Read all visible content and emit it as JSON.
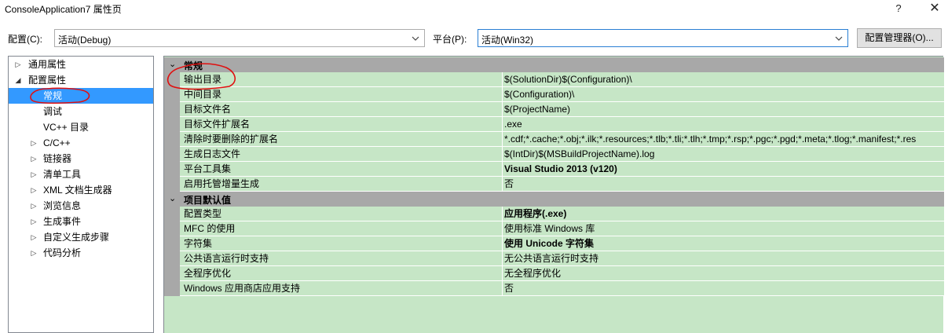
{
  "window": {
    "title": "ConsoleApplication7 属性页",
    "help_icon": "?",
    "close_icon": "✕"
  },
  "config_bar": {
    "config_label": "配置(C):",
    "config_value": "活动(Debug)",
    "platform_label": "平台(P):",
    "platform_value": "活动(Win32)",
    "manager_button": "配置管理器(O)..."
  },
  "tree": {
    "items": [
      {
        "label": "通用属性",
        "expander": "▷"
      },
      {
        "label": "配置属性",
        "expander": "◢"
      },
      {
        "label": "常规",
        "expander": ""
      },
      {
        "label": "调试",
        "expander": ""
      },
      {
        "label": "VC++ 目录",
        "expander": ""
      },
      {
        "label": "C/C++",
        "expander": "▷"
      },
      {
        "label": "链接器",
        "expander": "▷"
      },
      {
        "label": "清单工具",
        "expander": "▷"
      },
      {
        "label": "XML 文档生成器",
        "expander": "▷"
      },
      {
        "label": "浏览信息",
        "expander": "▷"
      },
      {
        "label": "生成事件",
        "expander": "▷"
      },
      {
        "label": "自定义生成步骤",
        "expander": "▷"
      },
      {
        "label": "代码分析",
        "expander": "▷"
      }
    ]
  },
  "grid": {
    "categories": [
      {
        "title": "常规",
        "collapse_icon": "⌄",
        "rows": [
          {
            "name": "输出目录",
            "value": "$(SolutionDir)$(Configuration)\\"
          },
          {
            "name": "中间目录",
            "value": "$(Configuration)\\"
          },
          {
            "name": "目标文件名",
            "value": "$(ProjectName)"
          },
          {
            "name": "目标文件扩展名",
            "value": ".exe"
          },
          {
            "name": "清除时要删除的扩展名",
            "value": "*.cdf;*.cache;*.obj;*.ilk;*.resources;*.tlb;*.tli;*.tlh;*.tmp;*.rsp;*.pgc;*.pgd;*.meta;*.tlog;*.manifest;*.res"
          },
          {
            "name": "生成日志文件",
            "value": "$(IntDir)$(MSBuildProjectName).log"
          },
          {
            "name": "平台工具集",
            "value": "Visual Studio 2013 (v120)"
          },
          {
            "name": "启用托管增量生成",
            "value": "否"
          }
        ]
      },
      {
        "title": "项目默认值",
        "collapse_icon": "⌄",
        "rows": [
          {
            "name": "配置类型",
            "value": "应用程序(.exe)"
          },
          {
            "name": "MFC 的使用",
            "value": "使用标准 Windows 库"
          },
          {
            "name": "字符集",
            "value": "使用 Unicode 字符集"
          },
          {
            "name": "公共语言运行时支持",
            "value": "无公共语言运行时支持"
          },
          {
            "name": "全程序优化",
            "value": "无全程序优化"
          },
          {
            "name": "Windows 应用商店应用支持",
            "value": "否"
          }
        ]
      }
    ]
  },
  "colors": {
    "grid_background": "#c6e6c6",
    "category_header": "#a8a8a8",
    "selection": "#3399ff",
    "annotation_ink": "#e01010"
  }
}
